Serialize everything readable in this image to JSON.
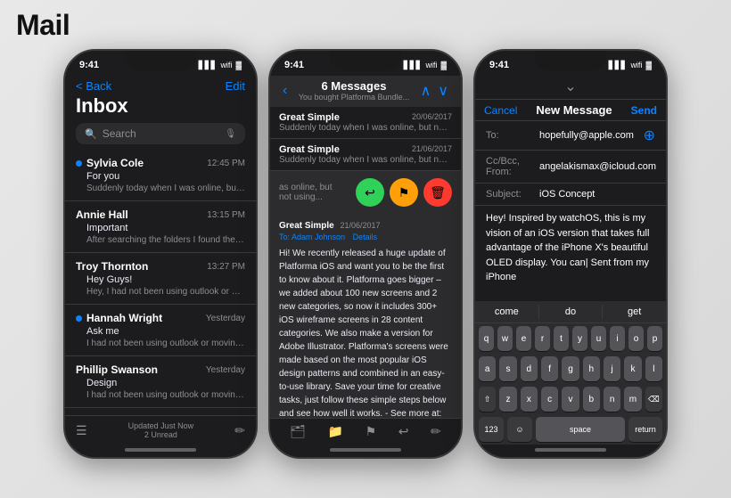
{
  "page": {
    "title": "Mail",
    "bg_color": "#e0e0e0"
  },
  "phone1": {
    "status": {
      "time": "9:41",
      "icons": "▲ ▲ ▲"
    },
    "nav": {
      "back": "< Back",
      "edit": "Edit"
    },
    "title": "Inbox",
    "search": {
      "placeholder": "Search",
      "mic": "🎙"
    },
    "emails": [
      {
        "sender": "Sylvia Cole",
        "time": "12:45 PM",
        "subject": "For you",
        "preview": "Suddenly today when I was online, but not using my Hotmail account, all the contents...",
        "unread": true
      },
      {
        "sender": "Annie Hall",
        "time": "13:15 PM",
        "subject": "Important",
        "preview": "After searching the folders I found the contents of my inbox in a random folder.",
        "unread": false
      },
      {
        "sender": "Troy Thornton",
        "time": "13:27 PM",
        "subject": "Hey Guys!",
        "preview": "Hey, I had not been using outlook or moving any folders. Also, I cannot seem to select all...",
        "unread": false
      },
      {
        "sender": "Hannah Wright",
        "time": "Yesterday",
        "subject": "Ask me",
        "preview": "I had not been using outlook or moving any folders. Also, I cannot seem to select all...",
        "unread": true
      },
      {
        "sender": "Phillip Swanson",
        "time": "Yesterday",
        "subject": "Design",
        "preview": "I had not been using outlook or moving any folders. Also, I cannot seem to select all...",
        "unread": false
      }
    ],
    "footer": {
      "updated": "Updated Just Now",
      "unread": "2 Unread"
    }
  },
  "phone2": {
    "status": {
      "time": "9:41"
    },
    "header": {
      "title": "6 Messages",
      "subtitle": "You bought Platforma Bundle..."
    },
    "thread_items": [
      {
        "sender": "Great Simple",
        "date": "20/06/2017",
        "preview": "Suddenly today when I was online, but not..."
      },
      {
        "sender": "Great Simple",
        "date": "21/06/2017",
        "preview": "Suddenly today when I was online, but not..."
      }
    ],
    "swipe_preview": "as online, but not using...",
    "email": {
      "from": "Great Simple",
      "to": "To: Adam Johnson",
      "date": "21/06/2017",
      "details": "Details",
      "body": "Hi! We recently released a huge update of Platforma iOS and want you to be the first to know about it. Platforma goes bigger – we added about 100 new screens and 2 new categories, so now it includes 300+ iOS wireframe screens in 28 content categories. We also make a version for Adobe Illustrator.\nPlatforma's screens were made based on the most popular iOS design patterns and combined in an easy-to-use library. Save your time for creative tasks, just follow these simple steps below and see how well it works. - See more at: http://ios.platforma.ws/#sthash.ZRmShwMM.dpuf"
    }
  },
  "phone3": {
    "status": {
      "time": "9:41"
    },
    "compose": {
      "cancel": "Cancel",
      "title": "New Message",
      "send": "Send",
      "to_label": "To:",
      "to_value": "hopefully@apple.com",
      "ccbcc_label": "Cc/Bcc, From:",
      "ccbcc_value": "angelakismax@icloud.com",
      "subject_label": "Subject:",
      "subject_value": "iOS Concept",
      "body": "Hey!\n\nInspired by watchOS, this is my vision of an iOS version that takes full advantage of the iPhone X's beautiful OLED display. You can|\n\nSent from my iPhone"
    },
    "keyboard": {
      "suggestions": [
        "come",
        "do",
        "get"
      ],
      "rows": [
        [
          "q",
          "w",
          "e",
          "r",
          "t",
          "y",
          "u",
          "i",
          "o",
          "p"
        ],
        [
          "a",
          "s",
          "d",
          "f",
          "g",
          "h",
          "j",
          "k",
          "l"
        ],
        [
          "z",
          "x",
          "c",
          "v",
          "b",
          "n",
          "m"
        ]
      ],
      "special": {
        "shift": "⇧",
        "delete": "⌫",
        "numbers": "123",
        "emoji": "☺",
        "space": "space",
        "return": "return"
      }
    }
  }
}
